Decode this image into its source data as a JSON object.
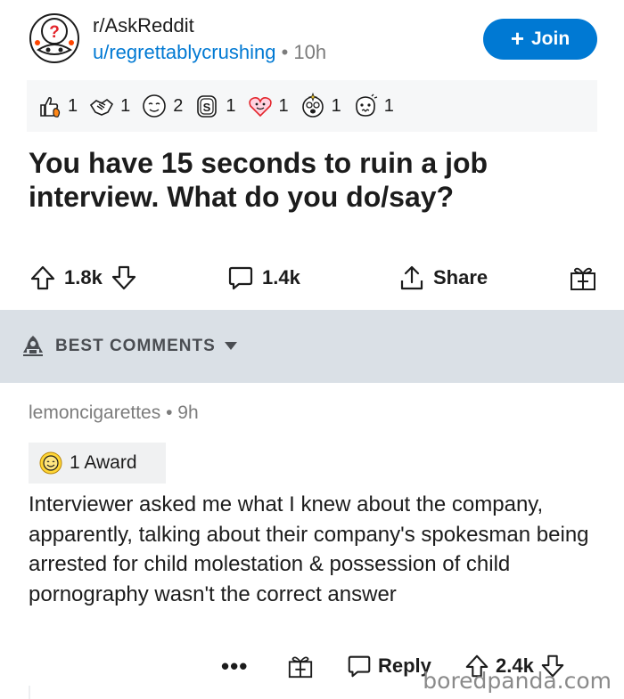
{
  "header": {
    "subreddit": "r/AskReddit",
    "username": "u/regrettablycrushing",
    "separator": "•",
    "time_ago": "10h",
    "join_label": "Join",
    "join_icon": "plus-icon"
  },
  "awards": [
    {
      "icon": "thumbs-up-fire-award-icon",
      "count": "1"
    },
    {
      "icon": "handshake-award-icon",
      "count": "1"
    },
    {
      "icon": "face-award-icon",
      "count": "2"
    },
    {
      "icon": "silver-coin-award-icon",
      "count": "1"
    },
    {
      "icon": "heart-face-award-icon",
      "count": "1"
    },
    {
      "icon": "sparkle-face-award-icon",
      "count": "1"
    },
    {
      "icon": "confused-face-award-icon",
      "count": "1"
    }
  ],
  "post": {
    "title": "You have 15 seconds to ruin a job interview. What do you do/say?",
    "upvotes": "1.8k",
    "comments": "1.4k",
    "share_label": "Share"
  },
  "sort": {
    "label": "BEST COMMENTS",
    "icon": "rocket-icon"
  },
  "comment": {
    "author": "lemoncigarettes",
    "separator": "•",
    "time_ago": "9h",
    "award_label": "1 Award",
    "body": "Interviewer asked me what I knew about the company, apparently, talking about their company's spokesman being arrested for child molestation & possession of child pornography wasn't the correct answer",
    "more_label": "•••",
    "reply_label": "Reply",
    "score": "2.4k"
  },
  "watermark": "boredpanda.com",
  "colors": {
    "accent": "#0079d3",
    "text": "#1c1c1c",
    "muted": "#7c7c7c",
    "sort_bar_bg": "#dae0e6",
    "award_bar_bg": "#f6f7f8"
  }
}
